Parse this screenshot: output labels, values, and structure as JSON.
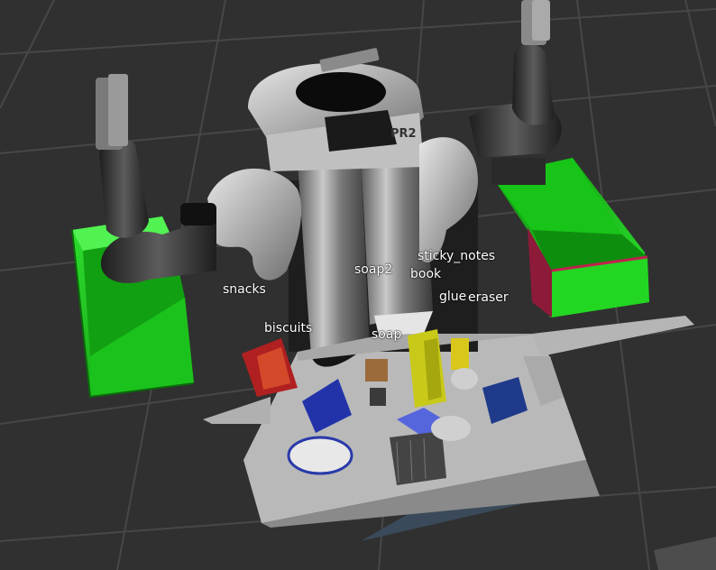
{
  "viewer": {
    "background_color": "#303030",
    "grid_color": "#4a4a4a"
  },
  "colors": {
    "bin": "#1cc21c",
    "bin_dark": "#0f7a0f",
    "table": "#bdbdbd",
    "robot_body": "#8f8f8f",
    "robot_dark": "#2a2a2a"
  },
  "robot": {
    "head_text": "PR2"
  },
  "objects": [
    {
      "id": "sticky_notes",
      "label": "sticky_notes"
    },
    {
      "id": "soap2",
      "label": "soap2"
    },
    {
      "id": "book",
      "label": "book"
    },
    {
      "id": "snacks",
      "label": "snacks"
    },
    {
      "id": "glue",
      "label": "glue"
    },
    {
      "id": "eraser",
      "label": "eraser"
    },
    {
      "id": "biscuits",
      "label": "biscuits"
    },
    {
      "id": "soap",
      "label": "soap"
    }
  ]
}
